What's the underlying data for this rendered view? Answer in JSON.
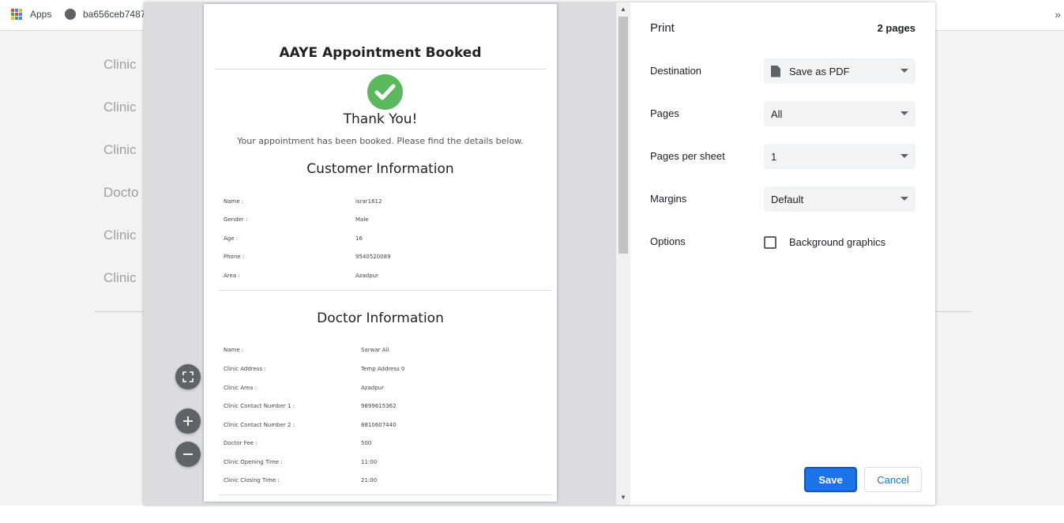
{
  "bookmarks": {
    "apps_label": "Apps",
    "site_label": "ba656ceb7487",
    "more_label": "»"
  },
  "background_page": {
    "items": [
      "Clinic",
      "Clinic",
      "Clinic",
      "Docto",
      "Clinic",
      "Clinic"
    ]
  },
  "preview": {
    "title": "AAYE Appointment Booked",
    "thank_you": "Thank You!",
    "subtitle": "Your appointment has been booked. Please find the details below.",
    "customer_heading": "Customer Information",
    "customer_rows": [
      {
        "label": "Name :",
        "value": "israr1612"
      },
      {
        "label": "Gender :",
        "value": "Male"
      },
      {
        "label": "Age :",
        "value": "16"
      },
      {
        "label": "Phone :",
        "value": "9540520089"
      },
      {
        "label": "Area :",
        "value": "Azadpur"
      }
    ],
    "doctor_heading": "Doctor Information",
    "doctor_rows": [
      {
        "label": "Name :",
        "value": "Sarwar Ali"
      },
      {
        "label": "Clinic Address :",
        "value": "Temp Address 0"
      },
      {
        "label": "Clinic Area :",
        "value": "Azadpur"
      },
      {
        "label": "Clinic Contact Number 1 :",
        "value": "9899615362"
      },
      {
        "label": "Clinic Contact Number 2 :",
        "value": "8810607440"
      },
      {
        "label": "Doctor Fee :",
        "value": "500"
      },
      {
        "label": "Clinic Opening Time :",
        "value": "11:00"
      },
      {
        "label": "Clinic Closing Time :",
        "value": "21:00"
      }
    ]
  },
  "settings": {
    "title": "Print",
    "pages_count": "2 pages",
    "destination_label": "Destination",
    "destination_value": "Save as PDF",
    "pages_label": "Pages",
    "pages_value": "All",
    "pps_label": "Pages per sheet",
    "pps_value": "1",
    "margins_label": "Margins",
    "margins_value": "Default",
    "options_label": "Options",
    "bg_graphics_label": "Background graphics",
    "save_label": "Save",
    "cancel_label": "Cancel"
  },
  "colors": {
    "accent": "#1a73e8",
    "check_green": "#5cb85c"
  },
  "icons": [
    "apps-icon",
    "globe-icon",
    "file-icon",
    "check-icon",
    "fit-to-page-icon",
    "zoom-in-icon",
    "zoom-out-icon",
    "dropdown-caret-icon"
  ]
}
